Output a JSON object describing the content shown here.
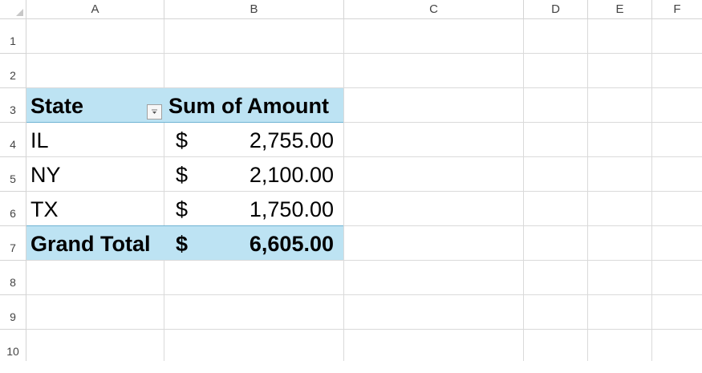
{
  "columns": [
    "A",
    "B",
    "C",
    "D",
    "E",
    "F"
  ],
  "rows": [
    "1",
    "2",
    "3",
    "4",
    "5",
    "6",
    "7",
    "8",
    "9",
    "10"
  ],
  "pivot": {
    "header_state": "State",
    "header_sum": "Sum of Amount",
    "filter_icon": "dropdown-filter-icon",
    "rows": [
      {
        "state": "IL",
        "currency": "$",
        "amount": "2,755.00"
      },
      {
        "state": "NY",
        "currency": "$",
        "amount": "2,100.00"
      },
      {
        "state": "TX",
        "currency": "$",
        "amount": "1,750.00"
      }
    ],
    "total": {
      "label": "Grand Total",
      "currency": "$",
      "amount": "6,605.00"
    }
  },
  "colors": {
    "pivot_header_fill": "#bde3f3",
    "pivot_border": "#6fb3d3",
    "gridline": "#dadada"
  }
}
